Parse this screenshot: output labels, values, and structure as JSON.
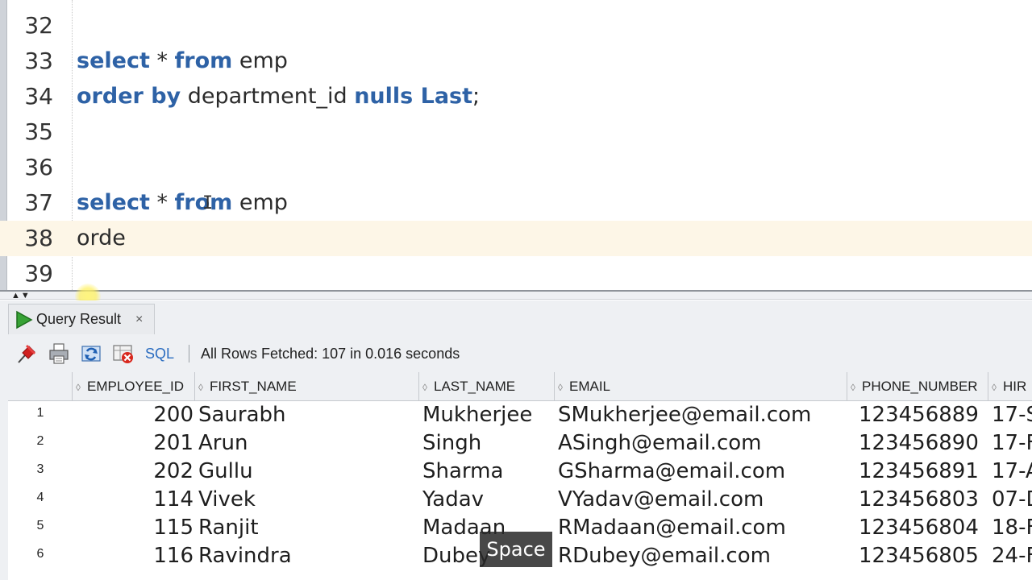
{
  "editor": {
    "lines": [
      {
        "number": "32",
        "tokens": []
      },
      {
        "number": "33",
        "tokens": [
          {
            "text": "select",
            "kw": true
          },
          {
            "text": " * ",
            "kw": false
          },
          {
            "text": "from",
            "kw": true
          },
          {
            "text": " emp",
            "kw": false
          }
        ]
      },
      {
        "number": "34",
        "tokens": [
          {
            "text": "order by",
            "kw": true
          },
          {
            "text": " department_id ",
            "kw": false
          },
          {
            "text": "nulls Last",
            "kw": true
          },
          {
            "text": ";",
            "kw": false
          }
        ]
      },
      {
        "number": "35",
        "tokens": []
      },
      {
        "number": "36",
        "tokens": []
      },
      {
        "number": "37",
        "tokens": [
          {
            "text": "select",
            "kw": true
          },
          {
            "text": " * ",
            "kw": false
          },
          {
            "text": "from",
            "kw": true
          },
          {
            "text": " emp",
            "kw": false
          }
        ]
      },
      {
        "number": "38",
        "tokens": [
          {
            "text": "orde",
            "kw": false
          }
        ],
        "current": true
      },
      {
        "number": "39",
        "tokens": []
      }
    ]
  },
  "results": {
    "tab_label": "Query Result",
    "tab_close": "×",
    "sql_label": "SQL",
    "status": "All Rows Fetched: 107 in 0.016 seconds",
    "columns": [
      "EMPLOYEE_ID",
      "FIRST_NAME",
      "LAST_NAME",
      "EMAIL",
      "PHONE_NUMBER",
      "HIR"
    ],
    "rows": [
      {
        "num": "1",
        "id": "200",
        "first": "Saurabh",
        "last": "Mukherjee",
        "email": "SMukherjee@email.com",
        "phone": "123456889",
        "hire": "17-S"
      },
      {
        "num": "2",
        "id": "201",
        "first": "Arun",
        "last": "Singh",
        "email": "ASingh@email.com",
        "phone": "123456890",
        "hire": "17-F"
      },
      {
        "num": "3",
        "id": "202",
        "first": "Gullu",
        "last": "Sharma",
        "email": "GSharma@email.com",
        "phone": "123456891",
        "hire": "17-A"
      },
      {
        "num": "4",
        "id": "114",
        "first": "Vivek",
        "last": "Yadav",
        "email": "VYadav@email.com",
        "phone": "123456803",
        "hire": "07-D"
      },
      {
        "num": "5",
        "id": "115",
        "first": "Ranjit",
        "last": "Madaan",
        "email": "RMadaan@email.com",
        "phone": "123456804",
        "hire": "18-F"
      },
      {
        "num": "6",
        "id": "116",
        "first": "Ravindra",
        "last": "Dubey",
        "email": "RDubey@email.com",
        "phone": "123456805",
        "hire": "24-F"
      }
    ]
  },
  "overlay": {
    "key": "Space"
  },
  "colors": {
    "keyword": "#2e62a6",
    "current_line": "#fdf6e7",
    "link": "#2a6cc0"
  }
}
